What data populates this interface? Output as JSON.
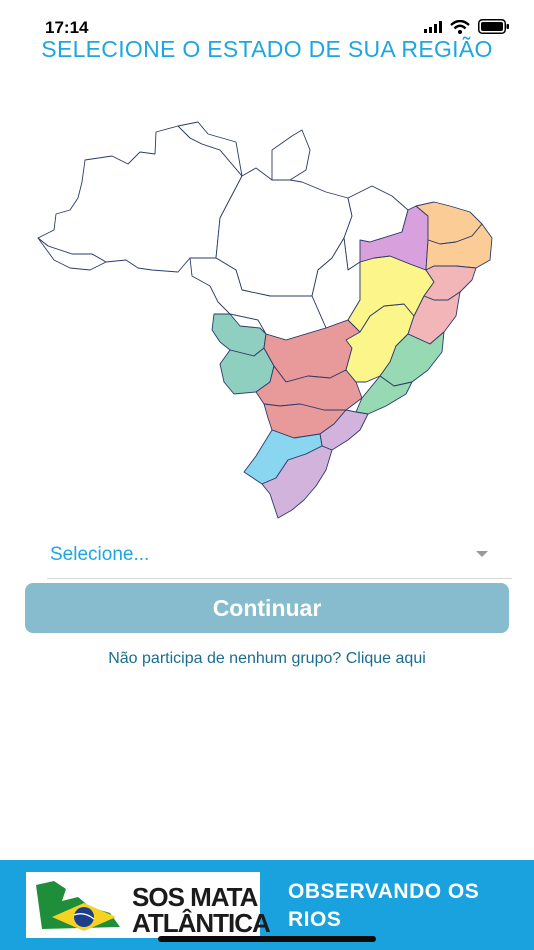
{
  "status_bar": {
    "time": "17:14"
  },
  "page": {
    "title": "SELECIONE O ESTADO DE SUA REGIÃO"
  },
  "state_select": {
    "value": "Selecione..."
  },
  "actions": {
    "continue_label": "Continuar",
    "no_group_link": "Não participa de nenhum grupo? Clique aqui"
  },
  "footer": {
    "logo_line1": "SOS MATA",
    "logo_line2": "ATLÂNTICA",
    "tagline_line1": "OBSERVANDO OS",
    "tagline_line2": "RIOS"
  },
  "icons": [
    "signal-icon",
    "wifi-icon",
    "battery-icon",
    "chevron-down-icon",
    "brazil-flag-icon"
  ],
  "colors": {
    "accent": "#1ea6e0",
    "button": "#86bccd",
    "footer": "#1aa2de",
    "link": "#1a6d8e",
    "region_pink": "#e89a9a",
    "region_yellow": "#fbf58a",
    "region_teal": "#8fcfbf",
    "region_violet": "#d8a0dc",
    "region_lilac": "#d2b3dc",
    "region_orange": "#fbcc96",
    "region_light_pink": "#f2b5b8",
    "region_green": "#97d9b3",
    "region_light_blue": "#8ad6f1"
  }
}
